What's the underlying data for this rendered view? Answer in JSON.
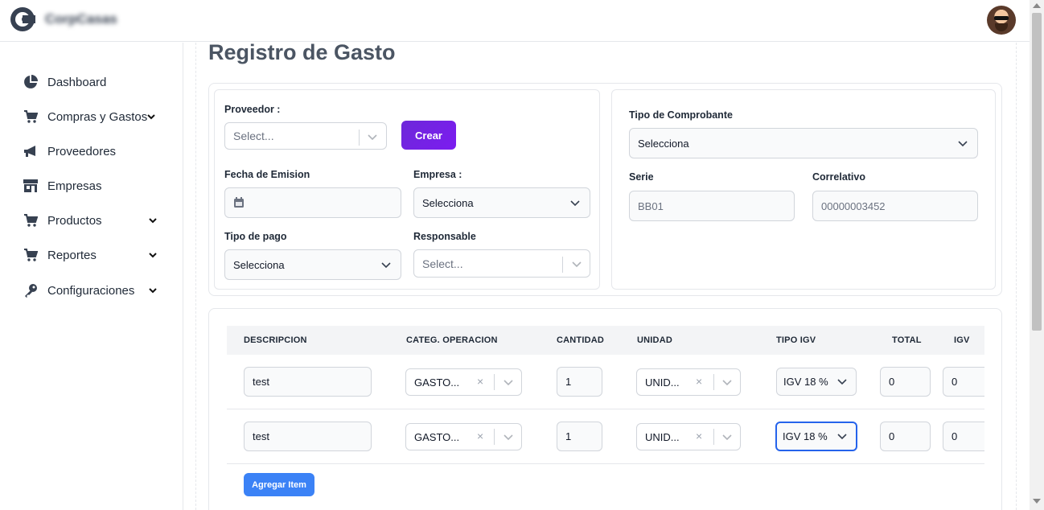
{
  "header": {
    "brand": "CorpCasas",
    "avatar_alt": "user avatar"
  },
  "sidebar": {
    "items": [
      {
        "label": "Dashboard",
        "icon": "pie-chart-icon",
        "has_chevron": false
      },
      {
        "label": "Compras y Gastos",
        "icon": "cart-icon",
        "has_chevron": true
      },
      {
        "label": "Proveedores",
        "icon": "megaphone-icon",
        "has_chevron": false
      },
      {
        "label": "Empresas",
        "icon": "store-icon",
        "has_chevron": false
      },
      {
        "label": "Productos",
        "icon": "cart-icon",
        "has_chevron": true
      },
      {
        "label": "Reportes",
        "icon": "cart-icon",
        "has_chevron": true
      },
      {
        "label": "Configuraciones",
        "icon": "key-icon",
        "has_chevron": true
      }
    ]
  },
  "page": {
    "title": "Registro de Gasto"
  },
  "form": {
    "proveedor": {
      "label": "Proveedor :",
      "placeholder": "Select..."
    },
    "crear_label": "Crear",
    "fecha_emision": {
      "label": "Fecha de Emision",
      "value": ""
    },
    "empresa": {
      "label": "Empresa :",
      "value": "Selecciona"
    },
    "tipo_pago": {
      "label": "Tipo de pago",
      "value": "Selecciona"
    },
    "responsable": {
      "label": "Responsable",
      "placeholder": "Select..."
    },
    "tipo_comprobante": {
      "label": "Tipo de Comprobante",
      "value": "Selecciona"
    },
    "serie": {
      "label": "Serie",
      "placeholder": "BB01"
    },
    "correlativo": {
      "label": "Correlativo",
      "placeholder": "00000003452"
    }
  },
  "table": {
    "columns": [
      "DESCRIPCION",
      "CATEG. OPERACION",
      "CANTIDAD",
      "UNIDAD",
      "TIPO IGV",
      "TOTAL",
      "IGV"
    ],
    "rows": [
      {
        "descripcion": "test",
        "categoria": "GASTO...",
        "cantidad": "1",
        "unidad": "UNID...",
        "tipo_igv": "IGV 18 %",
        "total": "0",
        "igv": "0"
      },
      {
        "descripcion": "test",
        "categoria": "GASTO...",
        "cantidad": "1",
        "unidad": "UNID...",
        "tipo_igv": "IGV 18 %",
        "total": "0",
        "igv": "0"
      }
    ],
    "add_item_label": "Agregar Item"
  },
  "colors": {
    "accent_purple": "#6d28d9",
    "accent_blue": "#3b82f6",
    "focus_blue": "#2563eb"
  }
}
